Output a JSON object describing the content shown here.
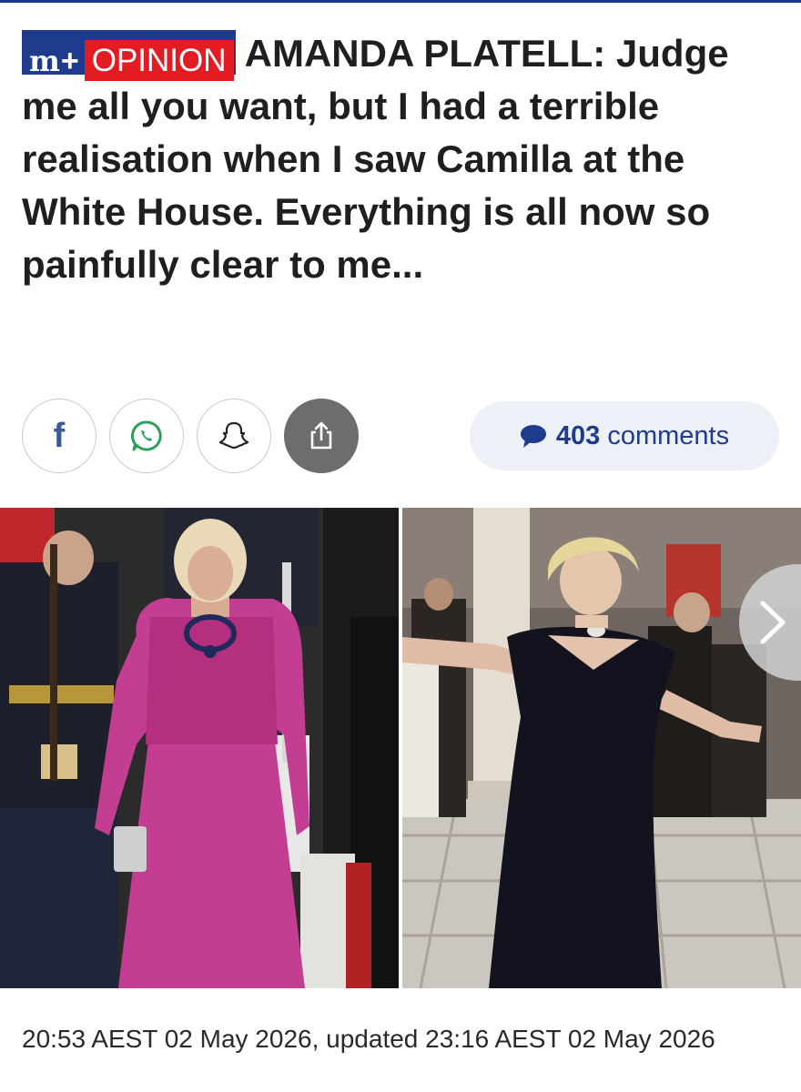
{
  "header": {
    "brand_mark": "m",
    "brand_plus": "+",
    "section": "OPINION",
    "headline": "AMANDA PLATELL: Judge me all you want, but I had a terrible realisation when I saw Camilla at the White House. Everything is all now so painfully clear to me..."
  },
  "share": {
    "facebook_glyph": "f",
    "buttons": [
      "facebook-icon",
      "whatsapp-icon",
      "snapchat-icon",
      "share-icon"
    ]
  },
  "comments": {
    "count": "403",
    "label": "comments"
  },
  "photos": [
    {
      "subject": "woman in pink dress with military honour guard"
    },
    {
      "subject": "woman in dark velvet gown dancing on checkered floor"
    }
  ],
  "carousel": {
    "next_icon": "chevron-right-icon"
  },
  "meta": {
    "timestamp": "20:53 AEST 02 May 2026, updated 23:16 AEST 02 May 2026"
  },
  "colors": {
    "brand_blue": "#1f3b8e",
    "opinion_red": "#e31b23",
    "comment_pill": "#edf0f6"
  }
}
